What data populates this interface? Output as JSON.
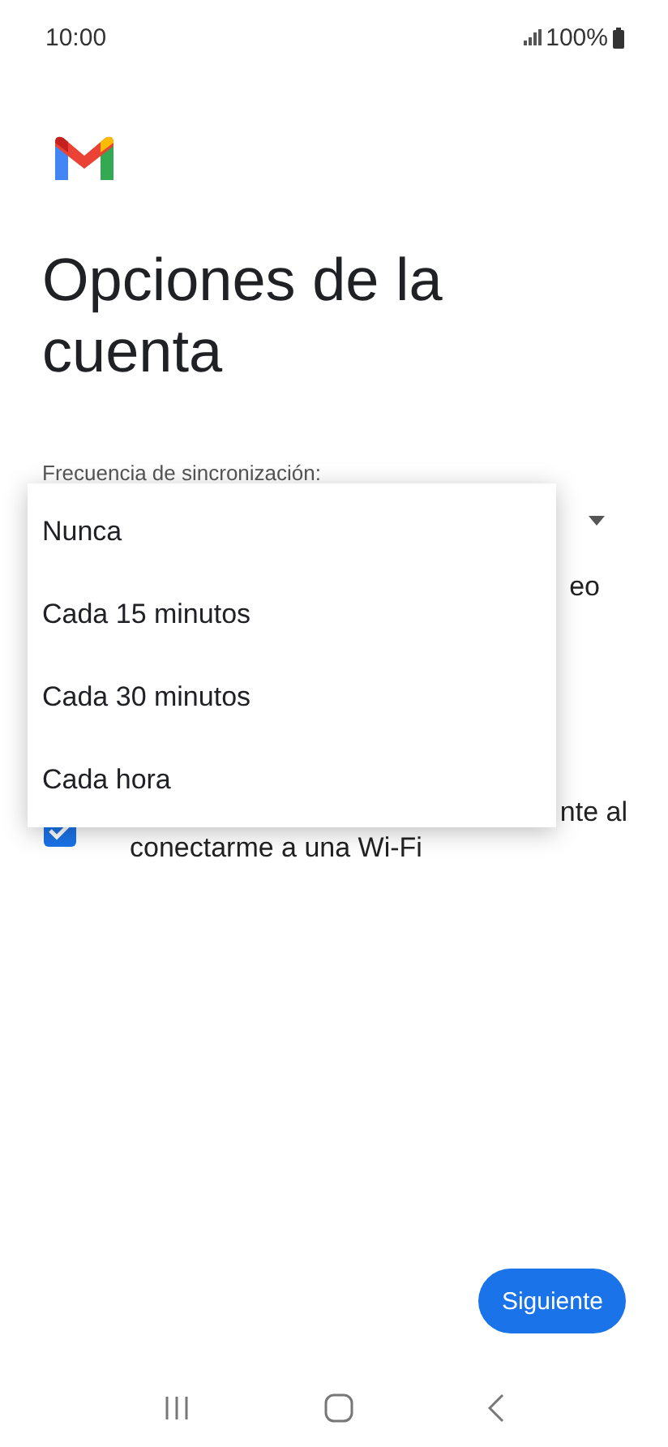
{
  "status_bar": {
    "time": "10:00",
    "battery": "100%"
  },
  "title": "Opciones de la cuenta",
  "sync_frequency": {
    "label": "Frecuencia de sincronización:",
    "expanded": true,
    "options": [
      {
        "label": "Nunca"
      },
      {
        "label": "Cada 15 minutos"
      },
      {
        "label": "Cada 30 minutos"
      },
      {
        "label": "Cada hora"
      }
    ]
  },
  "covered_option": {
    "text_fragment": "eo"
  },
  "wifi_option": {
    "checked": true,
    "text_fragment": "nte al",
    "text_line_2": "conectarme a una Wi-Fi"
  },
  "next_button": "Siguiente"
}
